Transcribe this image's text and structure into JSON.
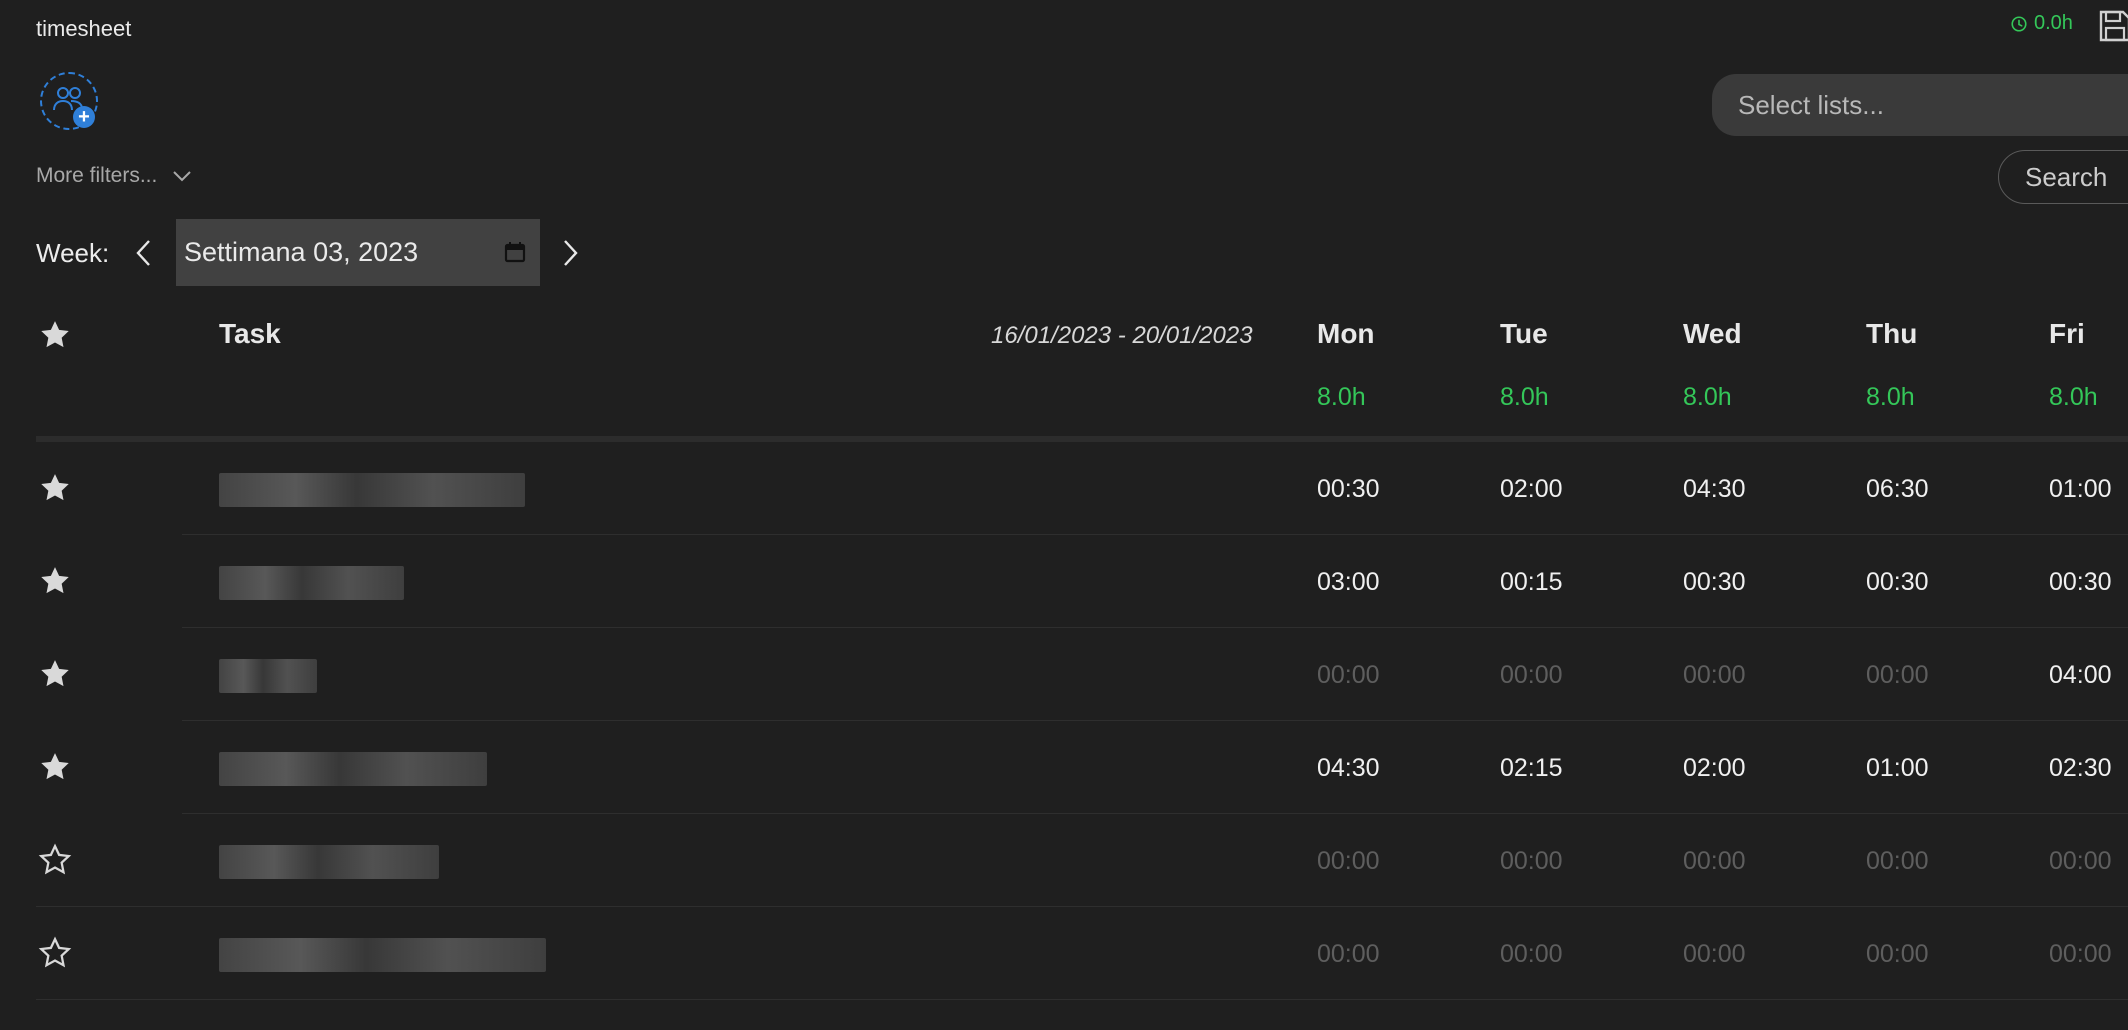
{
  "app": {
    "title": "timesheet"
  },
  "timer": {
    "value": "0.0h"
  },
  "toolbar": {
    "select_lists_placeholder": "Select lists...",
    "more_filters_label": "More filters...",
    "search_label": "Search"
  },
  "week": {
    "label": "Week:",
    "value": "Settimana 03, 2023"
  },
  "table": {
    "task_header": "Task",
    "date_range": "16/01/2023 - 20/01/2023",
    "days": [
      {
        "name": "Mon",
        "hours": "8.0h"
      },
      {
        "name": "Tue",
        "hours": "8.0h"
      },
      {
        "name": "Wed",
        "hours": "8.0h"
      },
      {
        "name": "Thu",
        "hours": "8.0h"
      },
      {
        "name": "Fri",
        "hours": "8.0h"
      }
    ],
    "rows": [
      {
        "starred": true,
        "values": [
          "00:30",
          "02:00",
          "04:30",
          "06:30",
          "01:00"
        ]
      },
      {
        "starred": true,
        "values": [
          "03:00",
          "00:15",
          "00:30",
          "00:30",
          "00:30"
        ]
      },
      {
        "starred": true,
        "values": [
          "00:00",
          "00:00",
          "00:00",
          "00:00",
          "04:00"
        ]
      },
      {
        "starred": true,
        "values": [
          "04:30",
          "02:15",
          "02:00",
          "01:00",
          "02:30"
        ]
      },
      {
        "starred": false,
        "values": [
          "00:00",
          "00:00",
          "00:00",
          "00:00",
          "00:00"
        ]
      },
      {
        "starred": false,
        "values": [
          "00:00",
          "00:00",
          "00:00",
          "00:00",
          "00:00"
        ]
      }
    ]
  },
  "colors": {
    "accent_green": "#34c759",
    "accent_blue": "#2f7fd8",
    "background": "#1f1f1f"
  }
}
